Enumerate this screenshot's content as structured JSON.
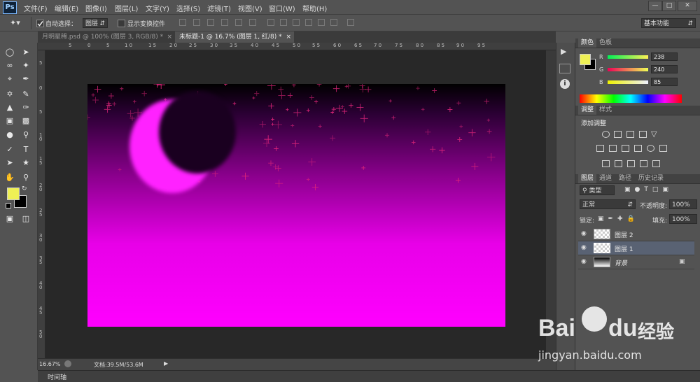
{
  "app": {
    "logo": "Ps"
  },
  "menu": [
    "文件(F)",
    "编辑(E)",
    "图像(I)",
    "图层(L)",
    "文字(Y)",
    "选择(S)",
    "滤镜(T)",
    "视图(V)",
    "窗口(W)",
    "帮助(H)"
  ],
  "window_controls": {
    "minimize": "—",
    "restore": "□",
    "close": "✕"
  },
  "options": {
    "auto_select_label": "自动选择：",
    "auto_select_checked": true,
    "auto_select_target": "图层",
    "show_transform_label": "显示变换控件",
    "show_transform_checked": false,
    "workspace": "基本功能"
  },
  "tabs": [
    {
      "title": "月明星稀.psd @ 100% (图层 3, RGB/8) *",
      "active": false
    },
    {
      "title": "未标题-1 @ 16.7% (图层 1, 红/8) *",
      "active": true
    }
  ],
  "tab_close": "×",
  "ruler_top_labels": [
    "5",
    "0",
    "5",
    "1 0",
    "1 5",
    "2 0",
    "2 5",
    "3 0",
    "3 5",
    "4 0",
    "4 5",
    "5 0",
    "5 5",
    "6 0",
    "6 5",
    "7 0",
    "7 5",
    "8 0",
    "8 5",
    "9 0",
    "9 5"
  ],
  "ruler_left_labels": [
    "5",
    "0",
    "5",
    "1 0",
    "1 5",
    "2 0",
    "2 5",
    "3 0",
    "3 5",
    "4 0",
    "4 5",
    "5 0"
  ],
  "status": {
    "zoom": "16.67%",
    "doc": "文档:39.5M/53.6M"
  },
  "timeline_label": "时间轴",
  "color_panel": {
    "tabs": [
      "颜色",
      "色板"
    ],
    "foreground": "#EEF055",
    "background": "#000000",
    "r": {
      "label": "R",
      "value": "238"
    },
    "g": {
      "label": "G",
      "value": "240"
    },
    "b": {
      "label": "B",
      "value": "85"
    }
  },
  "adjust_panel": {
    "tabs": [
      "调整",
      "样式"
    ],
    "heading": "添加调整"
  },
  "layers_panel": {
    "tabs": [
      "图层",
      "通道",
      "路径",
      "历史记录"
    ],
    "filter": "类型",
    "blend_mode": "正常",
    "opacity_label": "不透明度:",
    "opacity": "100%",
    "lock_label": "锁定:",
    "fill_label": "填充:",
    "fill": "100%",
    "layers": [
      {
        "name": "图层 2",
        "selected": false
      },
      {
        "name": "图层 1",
        "selected": true
      },
      {
        "name": "背景",
        "selected": false,
        "locked": true
      }
    ],
    "footer_icons": [
      "link-icon",
      "fx",
      "mask-icon",
      "adjustment-icon",
      "folder-icon",
      "new-layer-icon",
      "trash-icon"
    ]
  },
  "toolbox": {
    "foreground": "#EEF055",
    "background": "#000000"
  },
  "watermark": {
    "brand_a": "Bai",
    "brand_b": "du",
    "brand_c": "经验",
    "url": "jingyan.baidu.com"
  }
}
